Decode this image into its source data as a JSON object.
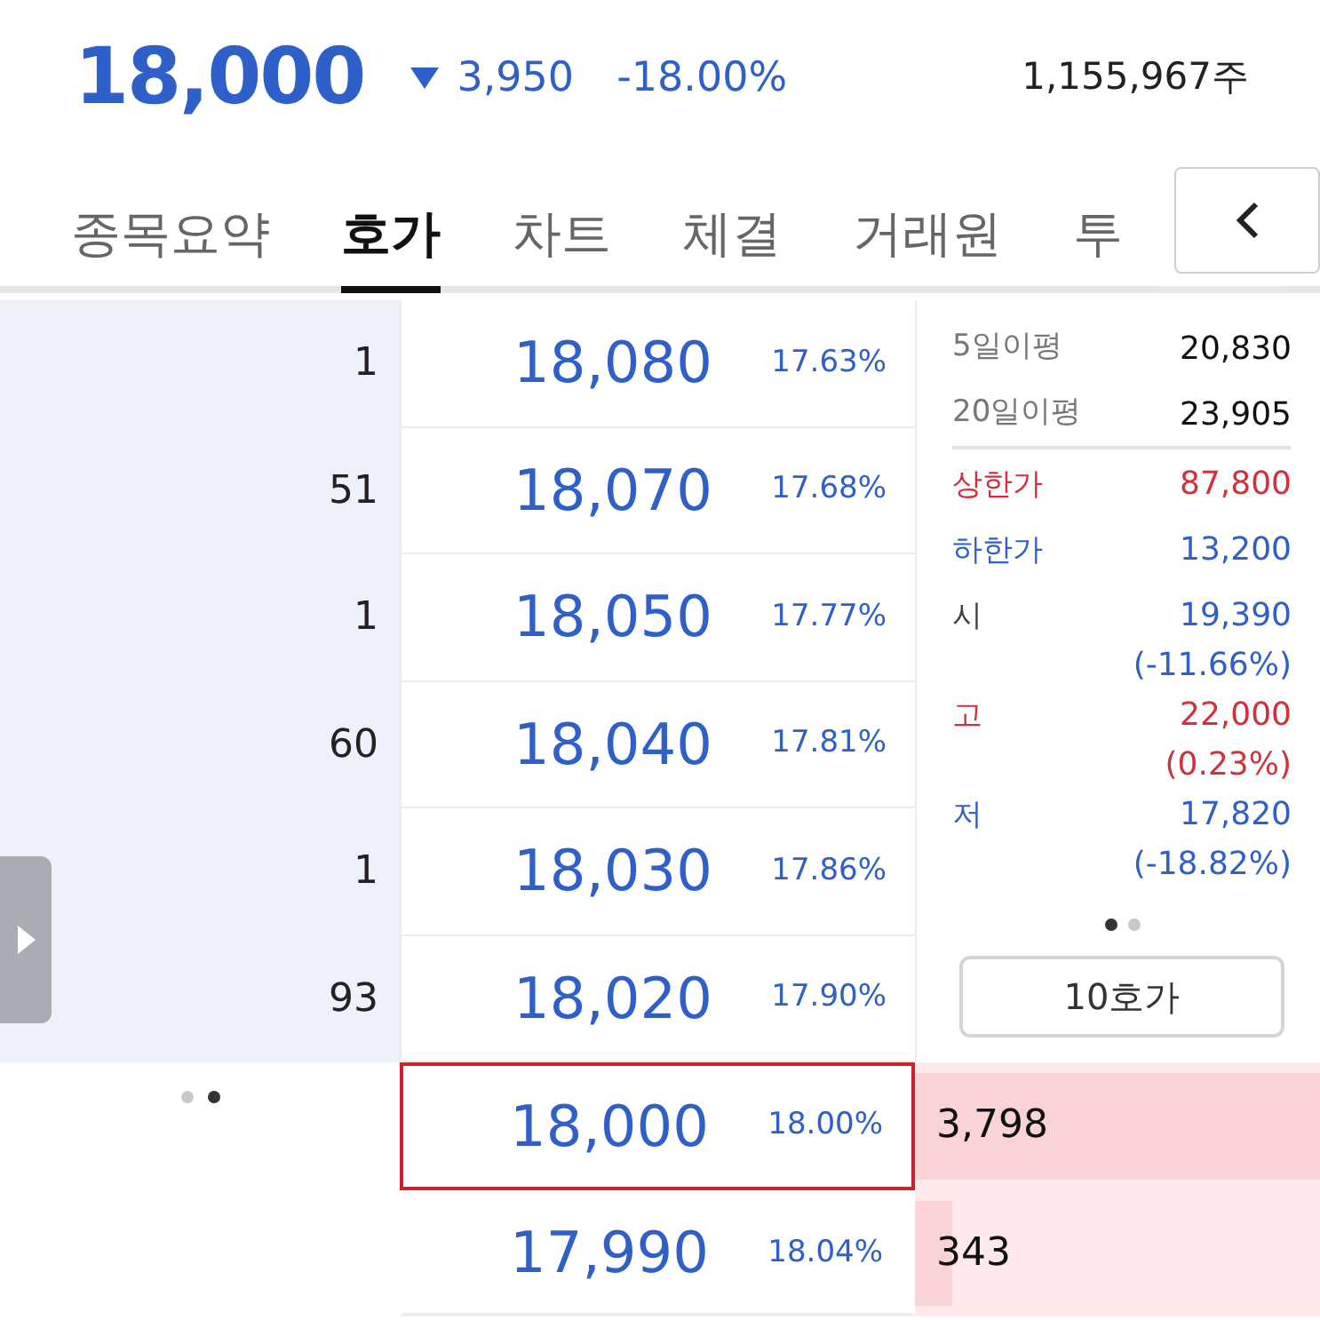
{
  "quote": {
    "price": "18,000",
    "falling": true,
    "change": "3,950",
    "rate": "-18.00%",
    "volume": "1,155,967주"
  },
  "tabs": [
    {
      "label": "종목요약",
      "selected": false
    },
    {
      "label": "호가",
      "selected": true
    },
    {
      "label": "차트",
      "selected": false
    },
    {
      "label": "체결",
      "selected": false
    },
    {
      "label": "거래원",
      "selected": false
    },
    {
      "label": "투",
      "selected": false
    }
  ],
  "sell_orders": [
    {
      "quantity": "1",
      "price": "18,080",
      "rate": "17.63%"
    },
    {
      "quantity": "51",
      "price": "18,070",
      "rate": "17.68%"
    },
    {
      "quantity": "1",
      "price": "18,050",
      "rate": "17.77%"
    },
    {
      "quantity": "60",
      "price": "18,040",
      "rate": "17.81%"
    },
    {
      "quantity": "1",
      "price": "18,030",
      "rate": "17.86%"
    },
    {
      "quantity": "93",
      "price": "18,020",
      "rate": "17.90%"
    }
  ],
  "buy_orders": [
    {
      "price": "18,000",
      "rate": "18.00%",
      "quantity": "3,798",
      "level": 1.0,
      "current": true
    },
    {
      "price": "17,990",
      "rate": "18.04%",
      "quantity": "343",
      "level": 0.09,
      "current": false
    }
  ],
  "info_panel": {
    "averages": [
      {
        "label": "5일이평",
        "value": "20,830"
      },
      {
        "label": "20일이평",
        "value": "23,905"
      }
    ],
    "stats": [
      {
        "label": "상한가",
        "label_colored": true,
        "value": "87,800",
        "color": "#d0313b"
      },
      {
        "label": "하한가",
        "label_colored": true,
        "value": "13,200",
        "color": "#2f5fc8"
      },
      {
        "label": "시",
        "label_colored": false,
        "value": "19,390",
        "sub": "(-11.66%)",
        "color": "#2f5fc8"
      },
      {
        "label": "고",
        "label_colored": true,
        "value": "22,000",
        "sub": "(0.23%)",
        "color": "#d0313b"
      },
      {
        "label": "저",
        "label_colored": true,
        "value": "17,820",
        "sub": "(-18.82%)",
        "color": "#2f5fc8"
      }
    ],
    "pages": [
      {
        "selected": true
      },
      {
        "selected": false
      }
    ],
    "button": "10호가"
  },
  "orderbook_pages": [
    {
      "selected": false
    },
    {
      "selected": true
    }
  ]
}
